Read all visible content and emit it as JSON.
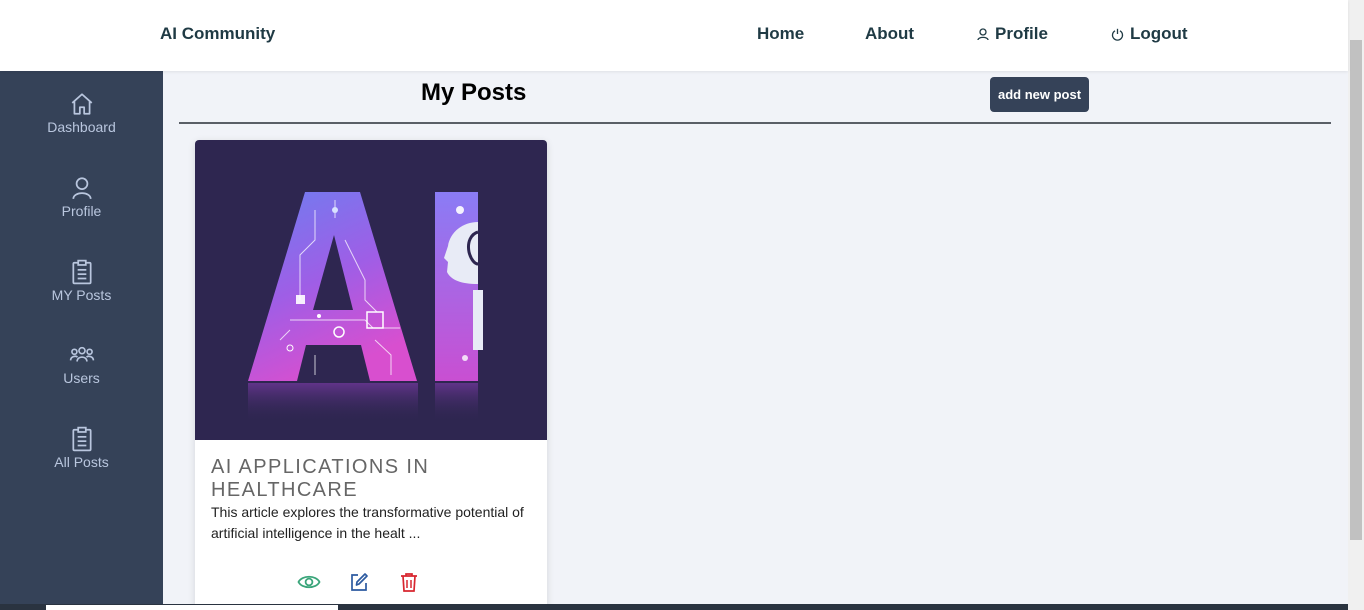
{
  "navbar": {
    "brand": "AI Community",
    "links": [
      {
        "label": "Home",
        "icon": ""
      },
      {
        "label": "About",
        "icon": ""
      },
      {
        "label": "Profile",
        "icon": "user-icon"
      },
      {
        "label": "Logout",
        "icon": "power-icon"
      }
    ]
  },
  "sidebar": {
    "items": [
      {
        "label": "Dashboard",
        "icon": "home-icon"
      },
      {
        "label": "Profile",
        "icon": "user-icon"
      },
      {
        "label": "MY Posts",
        "icon": "clipboard-icon"
      },
      {
        "label": "Users",
        "icon": "users-icon"
      },
      {
        "label": "All Posts",
        "icon": "clipboard-icon"
      }
    ]
  },
  "main": {
    "heading": "My Posts",
    "add_button": "add new post",
    "posts": [
      {
        "image_text": "AI",
        "title": "AI APPLICATIONS IN HEALTHCARE",
        "excerpt": "This article explores the transformative potential of artificial intelligence in the healt ...",
        "actions": [
          "view-icon",
          "edit-icon",
          "delete-icon"
        ]
      }
    ]
  },
  "colors": {
    "sidebar_bg": "#354258",
    "sidebar_text": "#b9c6de",
    "nav_text": "#1f3a44",
    "view": "#3aa57a",
    "edit": "#2c5aa0",
    "delete": "#d8262f"
  }
}
